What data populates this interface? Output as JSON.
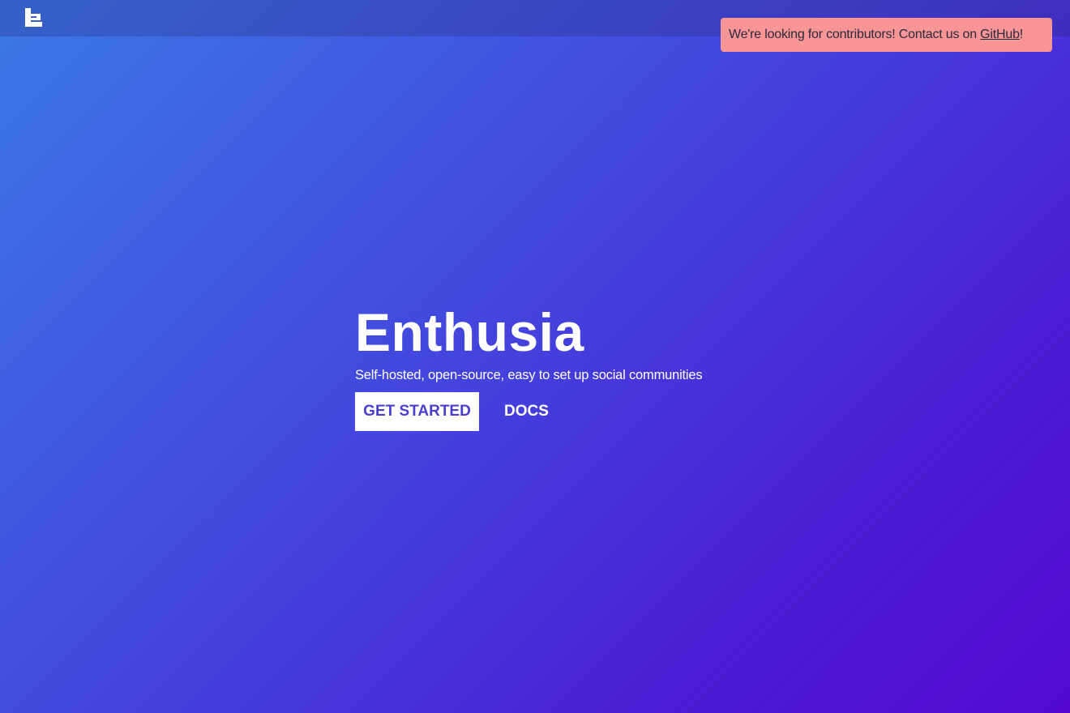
{
  "header": {
    "logo_icon": "enthusia-e-logo-icon"
  },
  "banner": {
    "text_before": "We're looking for contributors! Contact us on ",
    "link_label": "GitHub",
    "text_after": "!",
    "background_color": "#f99497"
  },
  "hero": {
    "title": "Enthusia",
    "subtitle": "Self-hosted, open-source, easy to set up social communities",
    "primary_button_label": "GET STARTED",
    "secondary_button_label": "DOCS"
  },
  "colors": {
    "gradient_start": "#3b78e7",
    "gradient_end": "#5508d1",
    "primary_button_text": "#4a3fd0"
  }
}
